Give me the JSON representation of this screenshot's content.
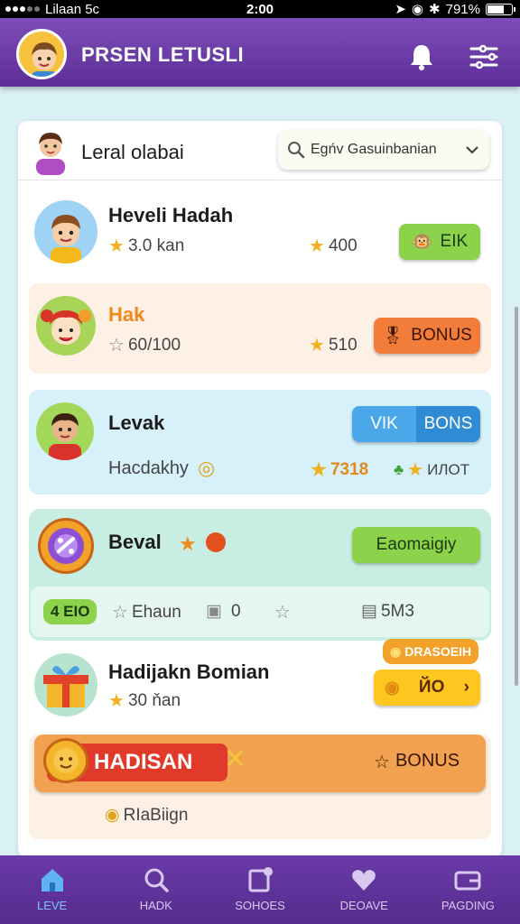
{
  "status_bar": {
    "carrier": "Lilaan 5c",
    "time": "2:00",
    "battery": "791%"
  },
  "header": {
    "title": "PRSEN LETUSLI"
  },
  "card": {
    "title": "Leral olabai",
    "search_placeholder": "Egńv Gasuinbanian"
  },
  "rows": [
    {
      "name": "Heveli Hadah",
      "stat1": "3.0 kan",
      "stat2": "400",
      "button": "EIK"
    },
    {
      "name": "Hak",
      "stat1": "60/100",
      "stat2": "510",
      "button": "BONUS"
    },
    {
      "name": "Levak",
      "sub": "Hacdakhy",
      "stat2": "7318",
      "stat3": "ИЛОТ",
      "button_left": "VIK",
      "button_right": "BONS"
    },
    {
      "name": "Beval",
      "button": "Eaomaigiy",
      "tag": "4 EIO",
      "stat1": "Ehaun",
      "stat2": "0",
      "stat3": "5M3"
    },
    {
      "name": "Hadijakn Bomian",
      "stat1": "30 ňan",
      "button": "ЙО",
      "tag": "DRASOEIH"
    },
    {
      "banner": "HADISAN",
      "button": "BONUS",
      "footer": "RIaBiign"
    }
  ],
  "bottom_nav": [
    {
      "label": "LEVE",
      "icon": "home-icon",
      "active": true
    },
    {
      "label": "HADK",
      "icon": "search-icon",
      "active": false
    },
    {
      "label": "SOHOES",
      "icon": "card-icon",
      "active": false
    },
    {
      "label": "DEOAVE",
      "icon": "heart-icon",
      "active": false
    },
    {
      "label": "PAGDING",
      "icon": "wallet-icon",
      "active": false
    }
  ],
  "colors": {
    "header": "#6a3aa8",
    "green": "#8cd24a",
    "orange": "#f27d3a",
    "blue": "#3a9ae0",
    "yellow": "#ffc61f",
    "red": "#e23a2a"
  }
}
